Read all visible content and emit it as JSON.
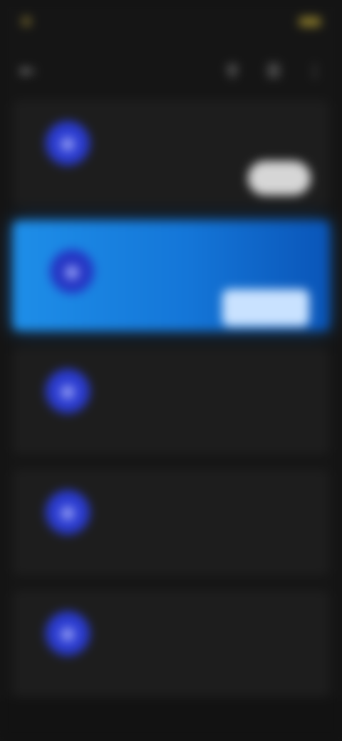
{
  "status_bar": {
    "time": "",
    "battery": ""
  },
  "header": {
    "title": ""
  },
  "items": [
    {
      "title": "",
      "subtitle": "",
      "caption": "",
      "button": "",
      "selected": false
    },
    {
      "title": "",
      "subtitle": "",
      "caption": "",
      "button": "",
      "selected": true
    },
    {
      "title": "",
      "subtitle": "",
      "caption": "",
      "button": "",
      "selected": false
    },
    {
      "title": "",
      "subtitle": "",
      "caption": "",
      "button": "",
      "selected": false
    },
    {
      "title": "",
      "subtitle": "",
      "caption": "",
      "button": "",
      "selected": false
    }
  ],
  "colors": {
    "background": "#151515",
    "card": "#1d1d1d",
    "accent": "#1476d8",
    "avatar": "#2a3bd0"
  },
  "icons": {
    "back": "arrow-left-icon",
    "search": "search-icon",
    "filter": "filter-icon",
    "more": "more-vertical-icon",
    "avatar": "user-icon"
  }
}
